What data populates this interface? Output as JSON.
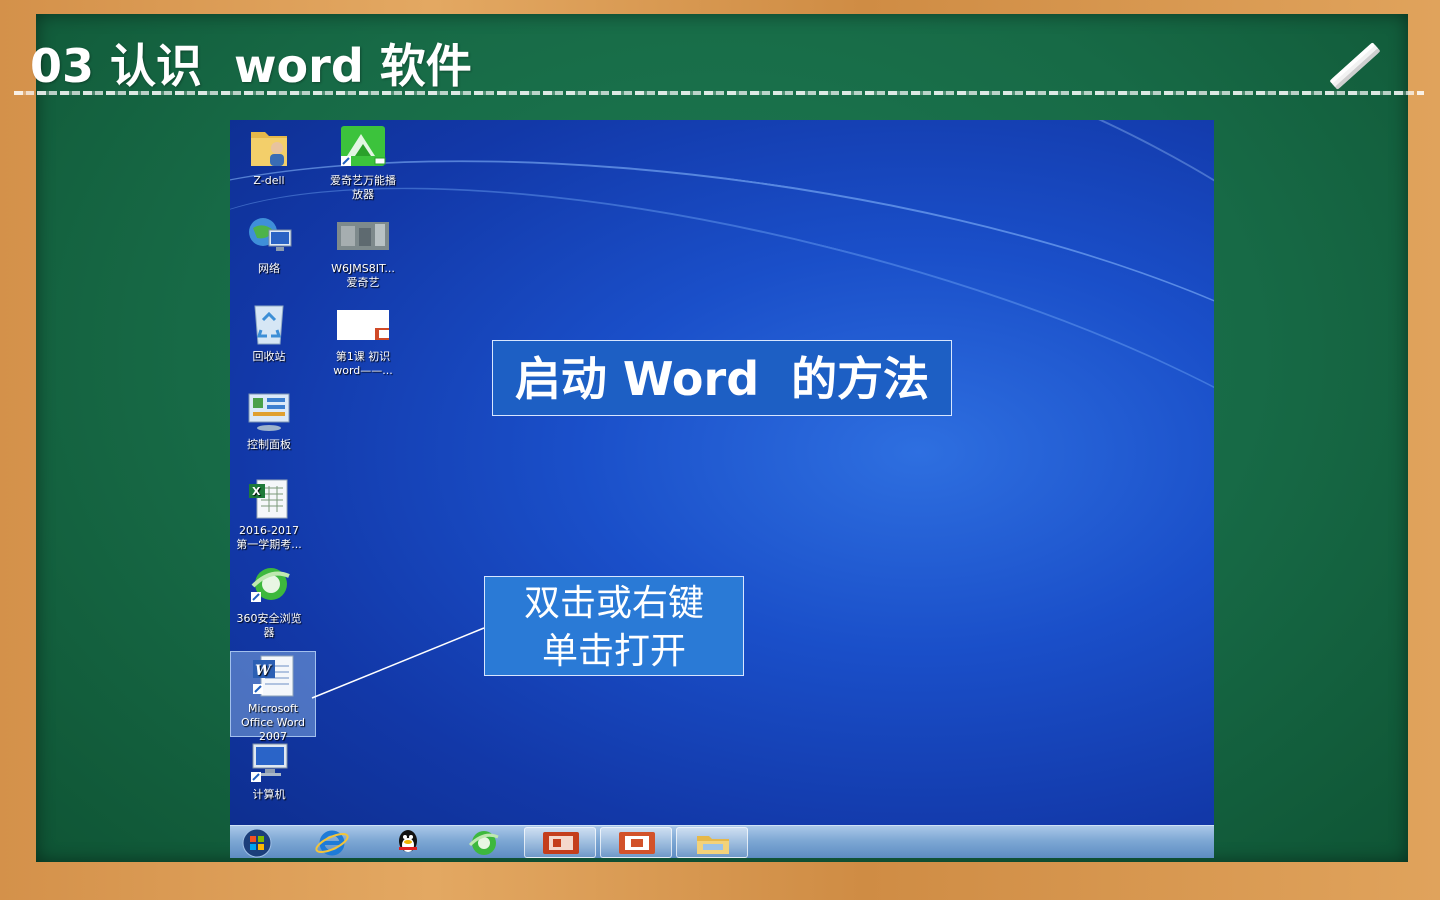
{
  "slide": {
    "title": "03 认识  word 软件"
  },
  "desktop": {
    "icons": [
      {
        "label1": "Z-dell",
        "label2": "",
        "icon": "user-folder-icon"
      },
      {
        "label1": "爱奇艺万能播",
        "label2": "放器",
        "icon": "iqiyi-player-icon"
      },
      {
        "label1": "网络",
        "label2": "",
        "icon": "network-icon"
      },
      {
        "label1": "W6JMS8IT...",
        "label2": "爱奇艺",
        "icon": "video-thumbnail-icon"
      },
      {
        "label1": "回收站",
        "label2": "",
        "icon": "recycle-bin-icon"
      },
      {
        "label1": "第1课 初识",
        "label2": "word——...",
        "icon": "powerpoint-file-icon"
      },
      {
        "label1": "控制面板",
        "label2": "",
        "icon": "control-panel-icon"
      },
      {
        "label1": "2016-2017",
        "label2": "第一学期考...",
        "icon": "excel-file-icon"
      },
      {
        "label1": "360安全浏览",
        "label2": "器",
        "icon": "browser-360-icon"
      },
      {
        "label1": "Microsoft",
        "label2": "Office Word",
        "label3": "2007",
        "icon": "word-icon"
      },
      {
        "label1": "计算机",
        "label2": "",
        "icon": "computer-icon"
      }
    ],
    "callout_main": "启动 Word  的方法",
    "callout_small_line1": "双击或右键",
    "callout_small_line2": "单击打开"
  },
  "taskbar": {
    "items": [
      "start-orb-icon",
      "internet-explorer-icon",
      "qq-icon",
      "browser-360-icon",
      "powerpoint-icon",
      "powerpoint-icon",
      "file-explorer-icon"
    ]
  }
}
